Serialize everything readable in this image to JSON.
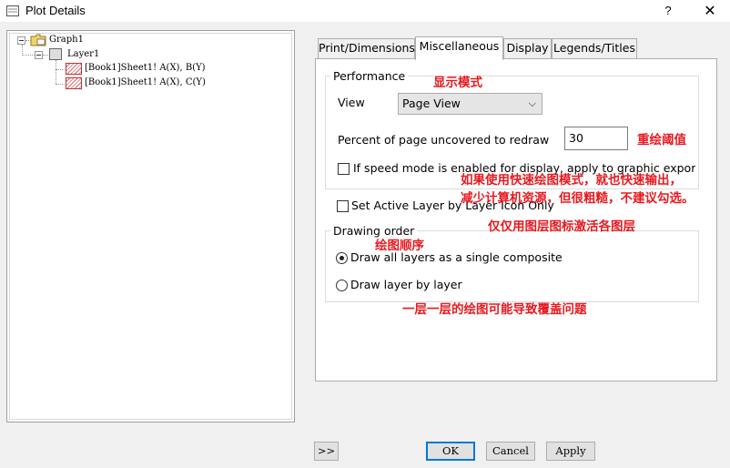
{
  "window": {
    "title": "Plot Details",
    "help_label": "?",
    "close_label": "✕"
  },
  "tree": {
    "graph": "Graph1",
    "layer": "Layer1",
    "plots": [
      "[Book1]Sheet1! A(X), B(Y)",
      "[Book1]Sheet1! A(X), C(Y)"
    ]
  },
  "tabs": [
    "Print/Dimensions",
    "Miscellaneous",
    "Display",
    "Legends/Titles"
  ],
  "active_tab": "Miscellaneous",
  "performance": {
    "group_title": "Performance",
    "view_label": "View",
    "view_value": "Page View",
    "redraw_label": "Percent of page uncovered to redraw",
    "redraw_value": "30",
    "speed_mode_label": "If speed mode is enabled for display, apply to graphic export as",
    "speed_mode_checked": false
  },
  "active_layer": {
    "label": "Set Active Layer by Layer Icon Only",
    "checked": false
  },
  "drawing_order": {
    "group_title": "Drawing order",
    "options": [
      "Draw all layers as a single composite",
      "Draw layer by layer"
    ],
    "selected_index": 0
  },
  "annotations": {
    "display_mode": "显示模式",
    "redraw_threshold": "重绘阈值",
    "speed_mode_line1": "如果使用快速绘图模式，就也快速输出，",
    "speed_mode_line2": "减少计算机资源，但很粗糙，不建议勾选。",
    "active_layer_note": "仅仅用图层图标激活各图层",
    "drawing_order_note": "绘图顺序",
    "layer_by_layer_note": "一层一层的绘图可能导致覆盖问题"
  },
  "buttons": {
    "expand": ">>",
    "ok": "OK",
    "cancel": "Cancel",
    "apply": "Apply"
  },
  "colors": {
    "annotation": "#e8191f",
    "default_button_border": "#0078d7"
  }
}
